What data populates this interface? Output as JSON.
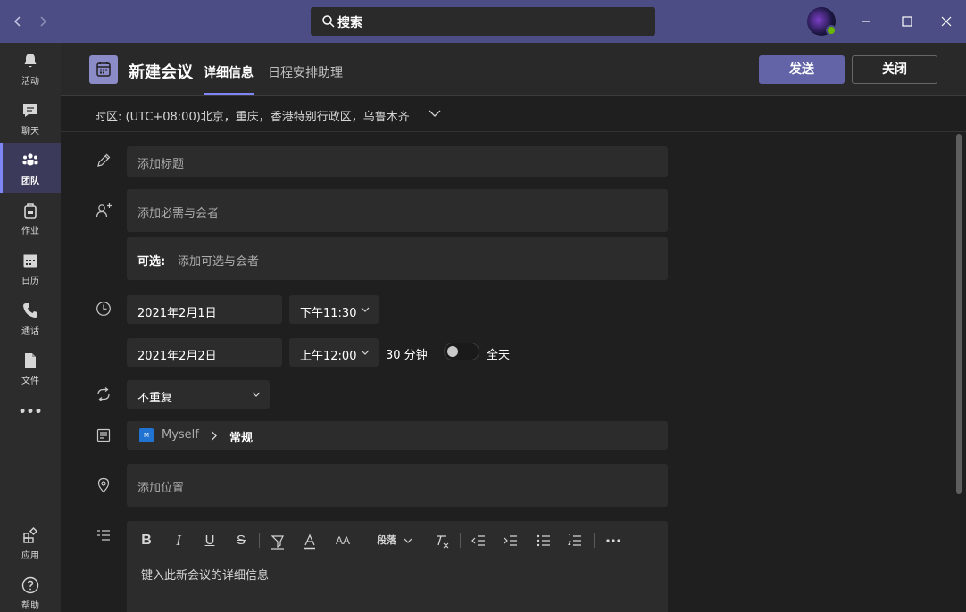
{
  "titlebar": {
    "search_label": "搜索"
  },
  "rail": {
    "items": [
      {
        "label": "活动"
      },
      {
        "label": "聊天"
      },
      {
        "label": "团队"
      },
      {
        "label": "作业"
      },
      {
        "label": "日历"
      },
      {
        "label": "通话"
      },
      {
        "label": "文件"
      }
    ],
    "more_label": "•••",
    "bottom": [
      {
        "label": "应用"
      },
      {
        "label": "帮助"
      }
    ]
  },
  "header": {
    "title": "新建会议",
    "tabs": [
      {
        "label": "详细信息",
        "active": true
      },
      {
        "label": "日程安排助理",
        "active": false
      }
    ],
    "send_label": "发送",
    "close_label": "关闭"
  },
  "timezone": {
    "label": "时区: (UTC+08:00)北京，重庆，香港特别行政区，乌鲁木齐"
  },
  "form": {
    "title_placeholder": "添加标题",
    "required_placeholder": "添加必需与会者",
    "optional_label": "可选:",
    "optional_placeholder": "添加可选与会者",
    "start_date": "2021年2月1日",
    "start_time": "下午11:30",
    "end_date": "2021年2月2日",
    "end_time": "上午12:00",
    "duration": "30 分钟",
    "all_day_label": "全天",
    "all_day": false,
    "repeat": "不重复",
    "channel_team_badge": "M",
    "channel_team": "Myself",
    "channel_name": "常规",
    "location_placeholder": "添加位置"
  },
  "editor": {
    "paragraph_label": "段落",
    "placeholder": "键入此新会议的详细信息"
  },
  "colors": {
    "titlebar": "#4b4d84",
    "accent": "#6264a7",
    "accent_light": "#7f85f5",
    "background": "#1f1f1f",
    "field": "#2c2c2c"
  }
}
